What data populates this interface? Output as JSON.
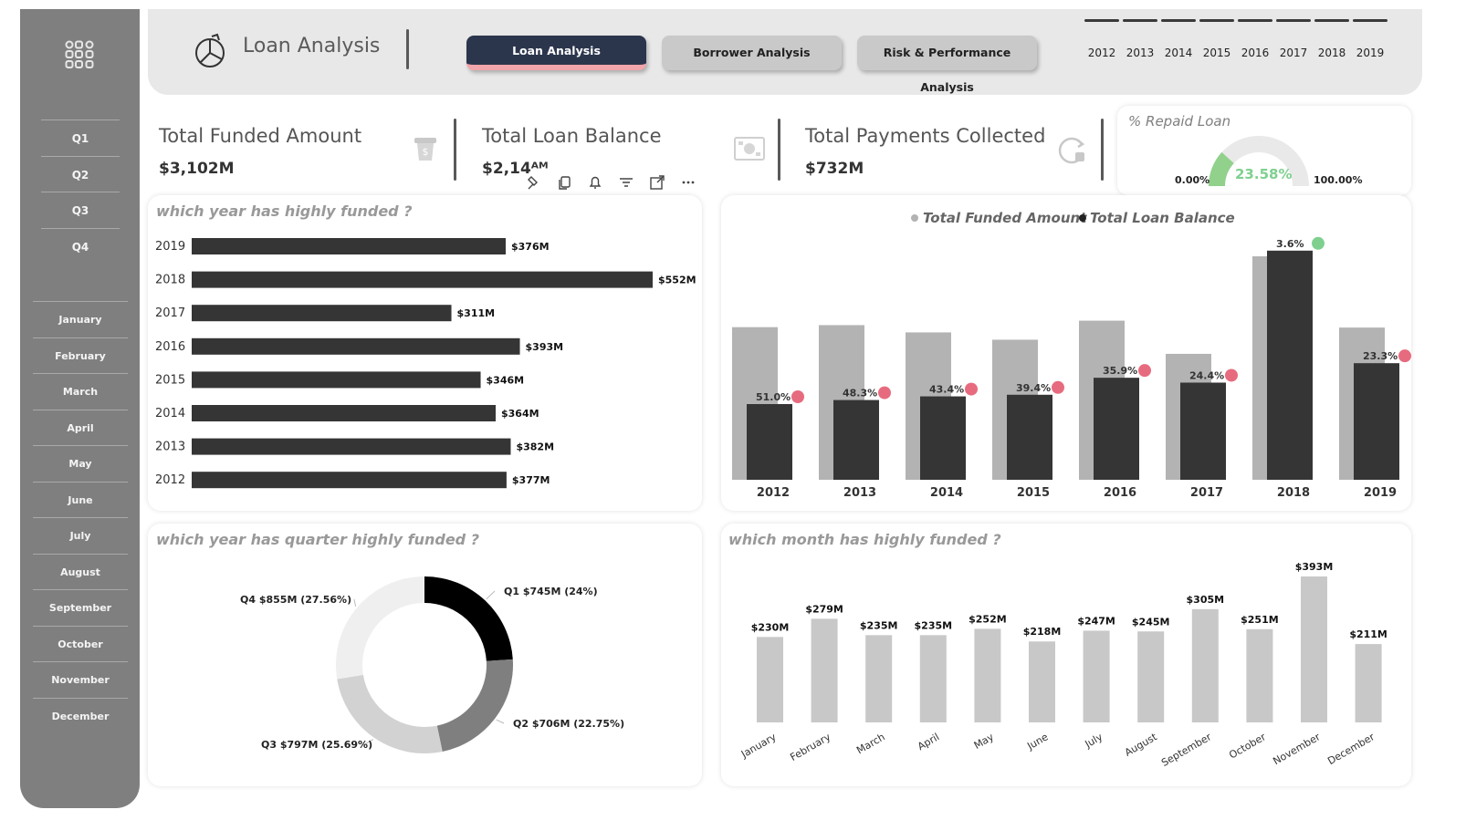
{
  "header": {
    "title": "Loan Analysis",
    "tabs": [
      {
        "label": "Loan Analysis",
        "active": true
      },
      {
        "label": "Borrower Analysis",
        "active": false
      },
      {
        "label": "Risk & Performance Analysis",
        "active": false
      }
    ],
    "years": [
      "2012",
      "2013",
      "2014",
      "2015",
      "2016",
      "2017",
      "2018",
      "2019"
    ]
  },
  "sidebar": {
    "quarters": [
      "Q1",
      "Q2",
      "Q3",
      "Q4"
    ],
    "months": [
      "January",
      "February",
      "March",
      "April",
      "May",
      "June",
      "July",
      "August",
      "September",
      "October",
      "November",
      "December"
    ]
  },
  "kpis": {
    "funded": {
      "title": "Total Funded Amount",
      "value": "$3,102M"
    },
    "balance": {
      "title": "Total Loan Balance",
      "value": "$2,14ᴬᴹ"
    },
    "payments": {
      "title": "Total Payments Collected",
      "value": "$732M"
    },
    "repaid": {
      "title": "% Repaid Loan",
      "value": "23.58%",
      "min": "0.00%",
      "max": "100.00%"
    }
  },
  "colors": {
    "dark": "#353535",
    "light": "#b3b3b3",
    "lighter": "#c8c8c8",
    "pink": "#e76b7e",
    "green": "#7fd08f",
    "gauge": "#91d18b"
  },
  "chart_data": [
    {
      "id": "yearly_funded",
      "type": "bar",
      "orientation": "horizontal",
      "title": "which year has highly funded ?",
      "categories": [
        "2019",
        "2018",
        "2017",
        "2016",
        "2015",
        "2014",
        "2013",
        "2012"
      ],
      "values": [
        376,
        552,
        311,
        393,
        346,
        364,
        382,
        377
      ],
      "labels": [
        "$376M",
        "$552M",
        "$311M",
        "$393M",
        "$346M",
        "$364M",
        "$382M",
        "$377M"
      ],
      "xlim": [
        0,
        552
      ]
    },
    {
      "id": "funded_vs_balance",
      "type": "bar",
      "title": "",
      "legend": [
        "Total Funded Amount",
        "Total Loan Balance"
      ],
      "categories": [
        "2012",
        "2013",
        "2014",
        "2015",
        "2016",
        "2017",
        "2018",
        "2019"
      ],
      "series": [
        {
          "name": "Total Funded Amount",
          "values": [
            377,
            382,
            364,
            346,
            393,
            311,
            552,
            376
          ]
        },
        {
          "name": "Total Loan Balance",
          "values": [
            187,
            197,
            206,
            210,
            252,
            240,
            566,
            288
          ]
        }
      ],
      "pct_labels": [
        "51.0%",
        "48.3%",
        "43.4%",
        "39.4%",
        "35.9%",
        "24.4%",
        "3.6%",
        "23.3%"
      ],
      "marker_status": [
        "pink",
        "pink",
        "pink",
        "pink",
        "pink",
        "pink",
        "green",
        "pink"
      ],
      "ylim": [
        0,
        600
      ]
    },
    {
      "id": "quarter_share",
      "type": "pie",
      "title": "which year has quarter highly funded ?",
      "slices": [
        {
          "label": "Q1 $745M (24%)",
          "value": 24.0,
          "color": "#000000"
        },
        {
          "label": "Q2 $706M (22.75%)",
          "value": 22.75,
          "color": "#7f7f7f"
        },
        {
          "label": "Q3 $797M (25.69%)",
          "value": 25.69,
          "color": "#d2d2d2"
        },
        {
          "label": "Q4 $855M (27.56%)",
          "value": 27.56,
          "color": "#efefef"
        }
      ]
    },
    {
      "id": "monthly_funded",
      "type": "bar",
      "title": "which month has highly funded ?",
      "categories": [
        "January",
        "February",
        "March",
        "April",
        "May",
        "June",
        "July",
        "August",
        "September",
        "October",
        "November",
        "December"
      ],
      "values": [
        230,
        279,
        235,
        235,
        252,
        218,
        247,
        245,
        305,
        251,
        393,
        211
      ],
      "labels": [
        "$230M",
        "$279M",
        "$235M",
        "$235M",
        "$252M",
        "$218M",
        "$247M",
        "$245M",
        "$305M",
        "$251M",
        "$393M",
        "$211M"
      ],
      "ylim": [
        0,
        400
      ]
    }
  ]
}
